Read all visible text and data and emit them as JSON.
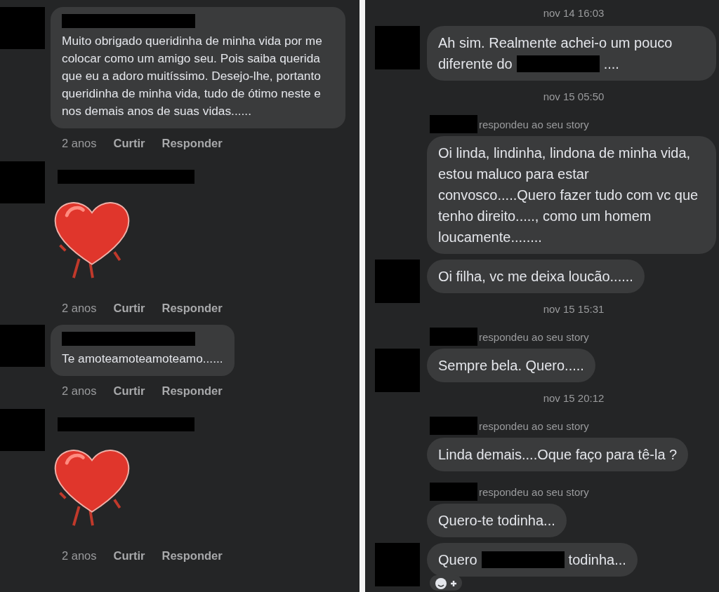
{
  "comments": [
    {
      "kind": "text",
      "name_redacted": true,
      "text": "Muito obrigado queridinha de minha vida por me colocar como um amigo seu. Pois saiba querida que eu a adoro muitíssimo. Desejo-lhe, portanto queridinha de minha vida, tudo de ótimo neste e nos demais anos de suas vidas......",
      "time": "2 anos",
      "actions": [
        "Curtir",
        "Responder"
      ]
    },
    {
      "kind": "sticker",
      "name_redacted": true,
      "time": "2 anos",
      "actions": [
        "Curtir",
        "Responder"
      ]
    },
    {
      "kind": "text",
      "name_redacted": true,
      "text": "Te amoteamoteamoteamo......",
      "time": "2 anos",
      "actions": [
        "Curtir",
        "Responder"
      ]
    },
    {
      "kind": "sticker",
      "name_redacted": true,
      "time": "2 anos",
      "actions": [
        "Curtir",
        "Responder"
      ]
    }
  ],
  "chat": [
    {
      "kind": "timestamp",
      "text": "nov 14 16:03"
    },
    {
      "kind": "message",
      "avatar": true,
      "parts": [
        {
          "kind": "text",
          "text": "Ah sim. Realmente achei-o um pouco"
        },
        {
          "kind": "text",
          "text": "diferente do"
        },
        {
          "kind": "redacted"
        },
        {
          "kind": "text",
          "text": "...."
        }
      ]
    },
    {
      "kind": "timestamp",
      "text": "nov 15 05:50"
    },
    {
      "kind": "reply_note",
      "text": "respondeu ao seu story"
    },
    {
      "kind": "message",
      "avatar": false,
      "parts": [
        {
          "kind": "text",
          "text": "Oi linda, lindinha, lindona de minha vida, estou maluco para estar convosco.....Quero fazer tudo com vc que tenho direito....., como um homem loucamente........"
        }
      ]
    },
    {
      "kind": "message",
      "avatar": true,
      "parts": [
        {
          "kind": "text",
          "text": "Oi filha, vc me deixa loucão......"
        }
      ]
    },
    {
      "kind": "timestamp",
      "text": "nov 15 15:31"
    },
    {
      "kind": "reply_note",
      "text": "respondeu ao seu story"
    },
    {
      "kind": "message",
      "avatar": true,
      "parts": [
        {
          "kind": "text",
          "text": "Sempre bela. Quero....."
        }
      ]
    },
    {
      "kind": "timestamp",
      "text": "nov 15 20:12"
    },
    {
      "kind": "reply_note",
      "text": "respondeu ao seu story"
    },
    {
      "kind": "message",
      "avatar": false,
      "parts": [
        {
          "kind": "text",
          "text": "Linda demais....Oque faço para tê-la ?"
        }
      ]
    },
    {
      "kind": "reply_note",
      "text": "respondeu ao seu story"
    },
    {
      "kind": "message",
      "avatar": false,
      "parts": [
        {
          "kind": "text",
          "text": "Quero-te todinha..."
        }
      ]
    },
    {
      "kind": "message",
      "avatar": true,
      "parts": [
        {
          "kind": "text",
          "text": "Quero"
        },
        {
          "kind": "redacted"
        },
        {
          "kind": "text",
          "text": "todinha..."
        }
      ],
      "add_reaction": true
    }
  ]
}
